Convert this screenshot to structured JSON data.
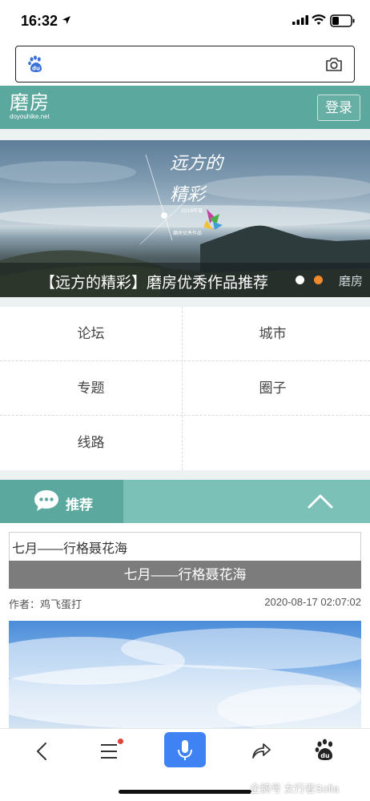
{
  "status_bar": {
    "time": "16:32",
    "icons": [
      "location-arrow-icon",
      "cellular-signal-icon",
      "wifi-icon",
      "battery-icon"
    ]
  },
  "url_bar": {
    "value": "",
    "icons": [
      "baidu-du-icon",
      "camera-icon"
    ]
  },
  "site_header": {
    "logo_text": "磨房",
    "logo_domain": "doyouhike.net",
    "login_label": "登录",
    "color": "#5ba89e"
  },
  "banner": {
    "caption": "【远方的精彩】磨房优秀作品推荐",
    "art_text_1": "远方的",
    "art_text_2": "精彩",
    "art_text_3": "2018年度",
    "art_text_4": "磨房优秀作品",
    "watermark": "磨房",
    "active_dot_color": "#f08a2c"
  },
  "nav": {
    "items": [
      "论坛",
      "城市",
      "专题",
      "圈子",
      "线路"
    ]
  },
  "recommend": {
    "label": "推荐",
    "icons": [
      "chat-bubble-icon",
      "chevron-up-icon"
    ]
  },
  "article": {
    "title": "七月——行格聂花海",
    "bar_title": "七月——行格聂花海",
    "author": "作者：鸡飞蛋打",
    "date": "2020-08-17 02:07:02"
  },
  "toolbar": {
    "icons": [
      "back-icon",
      "menu-icon",
      "microphone-icon",
      "share-icon",
      "baidu-paw-icon"
    ],
    "accent": "#3f82f3"
  },
  "watermark": "企鹅号 女行者Sofia"
}
